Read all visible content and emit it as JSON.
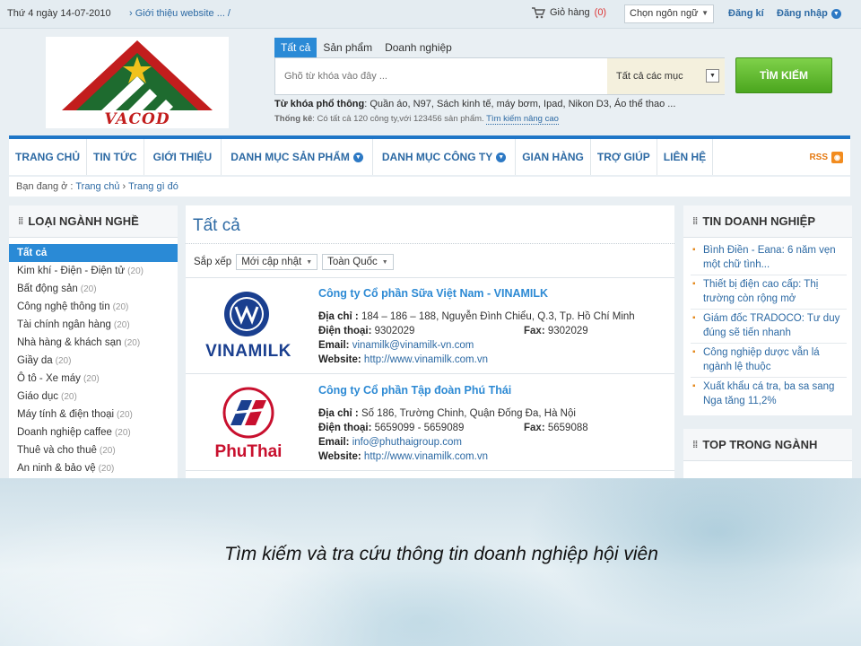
{
  "topbar": {
    "date": "Thứ 4 ngày 14-07-2010",
    "breadcrumb": "Giới thiệu website ... /",
    "cart_label": "Giỏ hàng",
    "cart_count": "(0)",
    "language_select": "Chọn ngôn ngữ",
    "register": "Đăng kí",
    "login": "Đăng nhập"
  },
  "logo": {
    "text": "VACOD",
    "colors": {
      "red": "#c21d1d",
      "green": "#1e6b2f",
      "star": "#f2c21b"
    }
  },
  "search": {
    "tabs": [
      "Tất cả",
      "Sản phẩm",
      "Doanh nghiệp"
    ],
    "placeholder": "Ghõ từ khóa vào đây ...",
    "category": "Tất cả các mục",
    "button": "TÌM KIẾM",
    "keywords_label": "Từ khóa phổ thông",
    "keywords": ": Quần áo, N97, Sách kinh tế, máy bơm, Ipad, Nikon D3, Áo thể thao ...",
    "stats_label": "Thống kê",
    "stats_text": ": Có tất cả 120 công ty,với 123456 sản phẩm.",
    "advanced_link": "Tìm kiếm nâng cao"
  },
  "nav": {
    "items": [
      "TRANG CHỦ",
      "TIN TỨC",
      "GIỚI THIỆU",
      "DANH MỤC SẢN PHẨM",
      "DANH MỤC CÔNG TY",
      "GIAN HÀNG",
      "TRỢ GIÚP",
      "LIÊN HỆ"
    ],
    "rss": "RSS"
  },
  "breadcrumb": {
    "label": "Bạn đang ở :",
    "home": "Trang chủ",
    "current": "Trang gì đó"
  },
  "sidebar": {
    "title": "LOẠI NGÀNH NGHỀ",
    "items": [
      {
        "label": "Tất cả",
        "count": ""
      },
      {
        "label": "Kim khí - Điện - Điện tử",
        "count": "(20)"
      },
      {
        "label": "Bất động sản",
        "count": "(20)"
      },
      {
        "label": "Công nghệ thông tin",
        "count": "(20)"
      },
      {
        "label": "Tài chính ngân hàng",
        "count": "(20)"
      },
      {
        "label": "Nhà hàng & khách sạn",
        "count": "(20)"
      },
      {
        "label": "Giầy da",
        "count": "(20)"
      },
      {
        "label": "Ô tô - Xe máy",
        "count": "(20)"
      },
      {
        "label": "Giáo dục",
        "count": "(20)"
      },
      {
        "label": "Máy tính & điện thoại",
        "count": "(20)"
      },
      {
        "label": "Doanh nghiệp caffee",
        "count": "(20)"
      },
      {
        "label": "Thuê và cho thuê",
        "count": "(20)"
      },
      {
        "label": "An ninh & bảo vệ",
        "count": "(20)"
      }
    ]
  },
  "main": {
    "title": "Tất cả",
    "sort_label": "Sắp xếp",
    "sort_option": "Mới cập nhật",
    "region_option": "Toàn Quốc",
    "companies": [
      {
        "name": "Công ty Cổ phần Sữa Việt Nam - VINAMILK",
        "logo_text": "VINAMILK",
        "address_label": "Địa chỉ :",
        "address": "184 – 186 – 188, Nguyễn Đình Chiểu, Q.3, Tp. Hồ Chí Minh",
        "phone_label": "Điện thoại:",
        "phone": "9302029",
        "fax_label": "Fax:",
        "fax": "9302029",
        "email_label": "Email:",
        "email": "vinamilk@vinamilk-vn.com",
        "website_label": "Website:",
        "website": "http://www.vinamilk.com.vn"
      },
      {
        "name": "Công ty Cổ phần Tập đoàn Phú Thái",
        "logo_text": "PhuThai",
        "address_label": "Địa chỉ :",
        "address": "Số 186, Trường Chinh, Quận Đống Đa, Hà Nội",
        "phone_label": "Điện thoại:",
        "phone": "5659099 - 5659089",
        "fax_label": "Fax:",
        "fax": "5659088",
        "email_label": "Email:",
        "email": "info@phuthaigroup.com",
        "website_label": "Website:",
        "website": "http://www.vinamilk.com.vn"
      }
    ]
  },
  "news": {
    "title": "TIN DOANH NGHIỆP",
    "items": [
      "Bình Điền - Eana: 6 năm vẹn một chữ tình...",
      "Thiết bị điện cao cấp: Thị trường còn rộng mở",
      "Giám đốc TRADOCO: Tư duy đúng sẽ tiến nhanh",
      "Công nghiệp dược vẫn lá ngành lệ thuộc",
      "Xuất khẩu cá tra, ba sa sang Nga tăng 11,2%"
    ]
  },
  "top": {
    "title": "TOP TRONG NGÀNH"
  },
  "caption": "Tìm kiếm và tra cứu thông tin doanh nghiệp hội viên",
  "colors": {
    "accent": "#2a8ad6",
    "link": "#2d6aa4",
    "search_button": "#5cb82a",
    "rss": "#f28c1f"
  }
}
